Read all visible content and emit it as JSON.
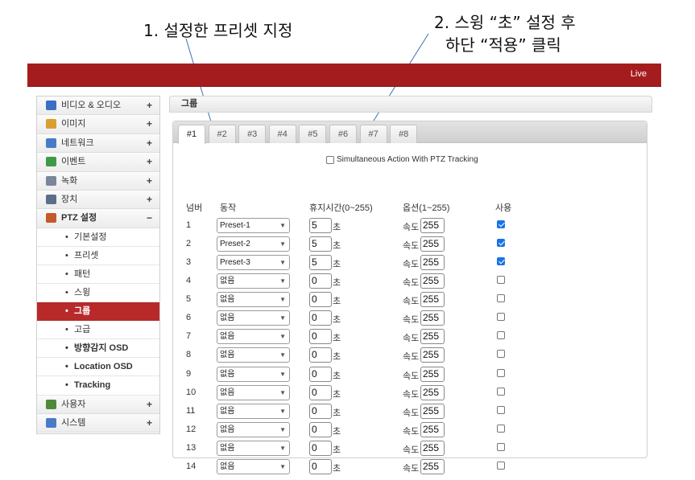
{
  "annotations": {
    "step1": "1. 설정한 프리셋 지정",
    "step2_line1": "2. 스윙 “초” 설정 후",
    "step2_line2": "하단 “적용” 클릭"
  },
  "topbar": {
    "live_label": "Live",
    "color": "#a51c1f"
  },
  "sidebar": {
    "items": [
      {
        "label": "비디오 & 오디오",
        "sign": "+",
        "icon": "video-audio-icon"
      },
      {
        "label": "이미지",
        "sign": "+",
        "icon": "image-icon"
      },
      {
        "label": "네트워크",
        "sign": "+",
        "icon": "network-icon"
      },
      {
        "label": "이벤트",
        "sign": "+",
        "icon": "event-icon"
      },
      {
        "label": "녹화",
        "sign": "+",
        "icon": "recording-icon"
      },
      {
        "label": "장치",
        "sign": "+",
        "icon": "device-icon"
      },
      {
        "label": "PTZ 설정",
        "sign": "−",
        "icon": "ptz-icon"
      }
    ],
    "ptz_sub": [
      {
        "label": "기본설정",
        "dot": "•"
      },
      {
        "label": "프리셋",
        "dot": "•"
      },
      {
        "label": "패턴",
        "dot": "•"
      },
      {
        "label": "스윙",
        "dot": "•"
      },
      {
        "label": "그룹",
        "dot": "•"
      },
      {
        "label": "고급",
        "dot": "•"
      },
      {
        "label": "방향감지 OSD",
        "dot": "•"
      },
      {
        "label": "Location OSD",
        "dot": "•"
      },
      {
        "label": "Tracking",
        "dot": "•"
      }
    ],
    "bottom_items": [
      {
        "label": "사용자",
        "sign": "+",
        "icon": "user-icon"
      },
      {
        "label": "시스템",
        "sign": "+",
        "icon": "system-icon"
      }
    ],
    "selected_color": "#b82a2a"
  },
  "content": {
    "title": "그룹",
    "tabs": [
      "#1",
      "#2",
      "#3",
      "#4",
      "#5",
      "#6",
      "#7",
      "#8"
    ],
    "active_tab": "#1",
    "simultaneous_label": "Simultaneous Action With PTZ Tracking",
    "simultaneous_checked": false,
    "headers": {
      "number": "넘버",
      "action": "동작",
      "dwell": "휴지시간(0~255)",
      "option": "옵션(1~255)",
      "use": "사용"
    },
    "unit_label": "초",
    "speed_label": "속도",
    "rows": [
      {
        "num": "1",
        "action": "Preset-1",
        "dwell": "5",
        "speed": "255",
        "use": true
      },
      {
        "num": "2",
        "action": "Preset-2",
        "dwell": "5",
        "speed": "255",
        "use": true
      },
      {
        "num": "3",
        "action": "Preset-3",
        "dwell": "5",
        "speed": "255",
        "use": true
      },
      {
        "num": "4",
        "action": "없음",
        "dwell": "0",
        "speed": "255",
        "use": false
      },
      {
        "num": "5",
        "action": "없음",
        "dwell": "0",
        "speed": "255",
        "use": false
      },
      {
        "num": "6",
        "action": "없음",
        "dwell": "0",
        "speed": "255",
        "use": false
      },
      {
        "num": "7",
        "action": "없음",
        "dwell": "0",
        "speed": "255",
        "use": false
      },
      {
        "num": "8",
        "action": "없음",
        "dwell": "0",
        "speed": "255",
        "use": false
      },
      {
        "num": "9",
        "action": "없음",
        "dwell": "0",
        "speed": "255",
        "use": false
      },
      {
        "num": "10",
        "action": "없음",
        "dwell": "0",
        "speed": "255",
        "use": false
      },
      {
        "num": "11",
        "action": "없음",
        "dwell": "0",
        "speed": "255",
        "use": false
      },
      {
        "num": "12",
        "action": "없음",
        "dwell": "0",
        "speed": "255",
        "use": false
      },
      {
        "num": "13",
        "action": "없음",
        "dwell": "0",
        "speed": "255",
        "use": false
      },
      {
        "num": "14",
        "action": "없음",
        "dwell": "0",
        "speed": "255",
        "use": false
      }
    ],
    "checkbox_color": "#1a73e8"
  }
}
